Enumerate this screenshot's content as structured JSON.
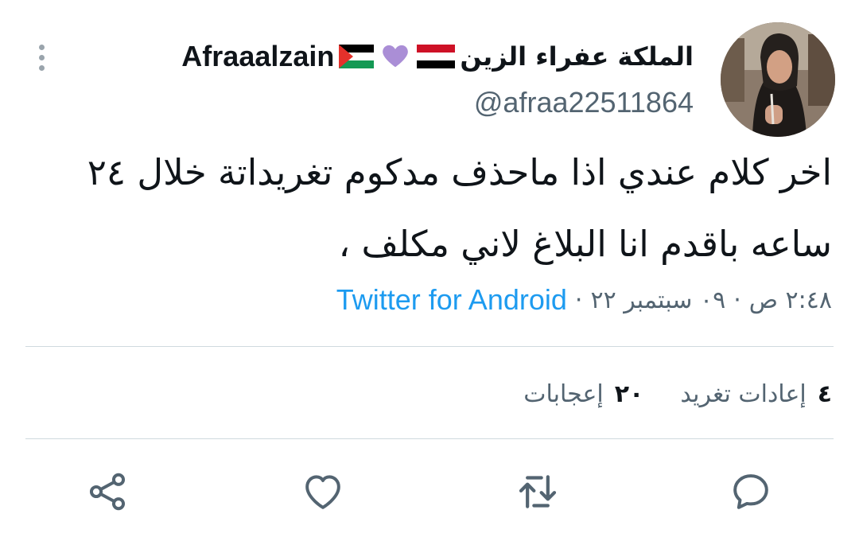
{
  "tweet": {
    "author": {
      "name_arabic": "الملكة عفراء الزين",
      "name_latin": "Afraaalzain",
      "emoji_icons": [
        "yemen-flag-icon",
        "purple-heart-icon",
        "palestine-flag-icon"
      ],
      "handle": "@afraa22511864"
    },
    "text": "اخر كلام عندي اذا ماحذف مدكوم تغريداتة خلال ٢٤ ساعه باقدم انا البلاغ لاني مكلف ،",
    "time": "٢:٤٨ ص",
    "date": "٠٩ سبتمبر ٢٢",
    "separator": "·",
    "source": "Twitter for Android",
    "stats": {
      "retweets_count": "٤",
      "retweets_label": "إعادات تغريد",
      "likes_count": "٢٠",
      "likes_label": "إعجابات"
    },
    "actions": [
      "reply-icon",
      "retweet-icon",
      "like-icon",
      "share-icon"
    ]
  },
  "colors": {
    "text_primary": "#0f1419",
    "text_secondary": "#536471",
    "link": "#1d9bf0",
    "divider": "#cfd9de",
    "icon": "#536471"
  }
}
